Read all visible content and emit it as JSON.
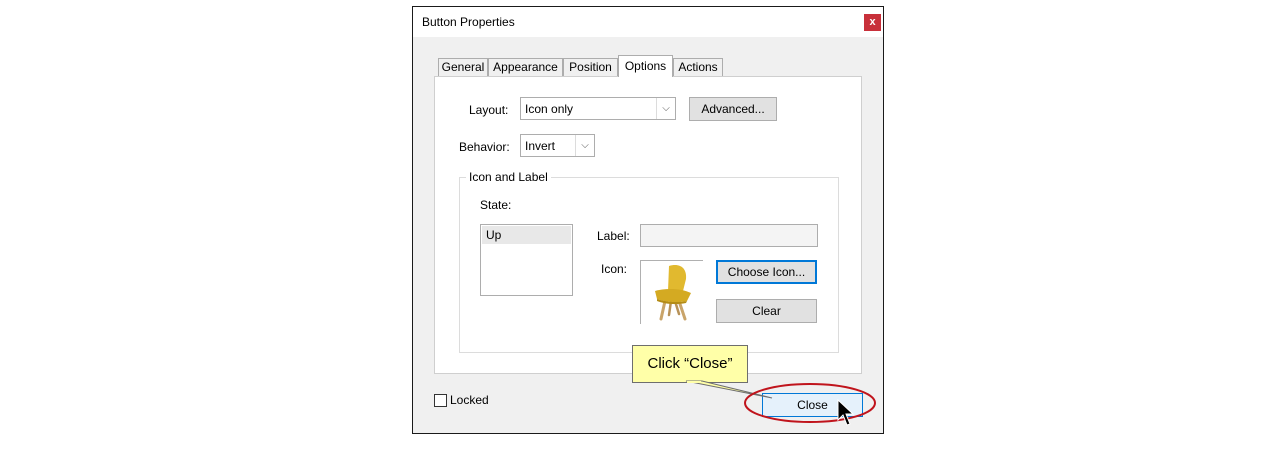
{
  "dialog": {
    "title": "Button Properties",
    "close_glyph": "x"
  },
  "tabs": [
    "General",
    "Appearance",
    "Position",
    "Options",
    "Actions"
  ],
  "active_tab": "Options",
  "options": {
    "layout_label": "Layout:",
    "layout_value": "Icon only",
    "advanced_label": "Advanced...",
    "behavior_label": "Behavior:",
    "behavior_value": "Invert",
    "group_title": "Icon and Label",
    "state_label": "State:",
    "state_items": [
      "Up"
    ],
    "label_field_label": "Label:",
    "label_field_value": "",
    "icon_label": "Icon:",
    "choose_icon_label": "Choose Icon...",
    "clear_label": "Clear"
  },
  "footer": {
    "locked_label": "Locked",
    "locked_checked": false,
    "close_label": "Close"
  },
  "annotation": {
    "callout_text": "Click “Close”",
    "highlight_color": "#c0141c",
    "callout_color": "#ffffa8"
  },
  "icons": {
    "dropdown": "chevron-down-icon",
    "preview": "chair-image",
    "cursor": "mouse-pointer-icon"
  }
}
